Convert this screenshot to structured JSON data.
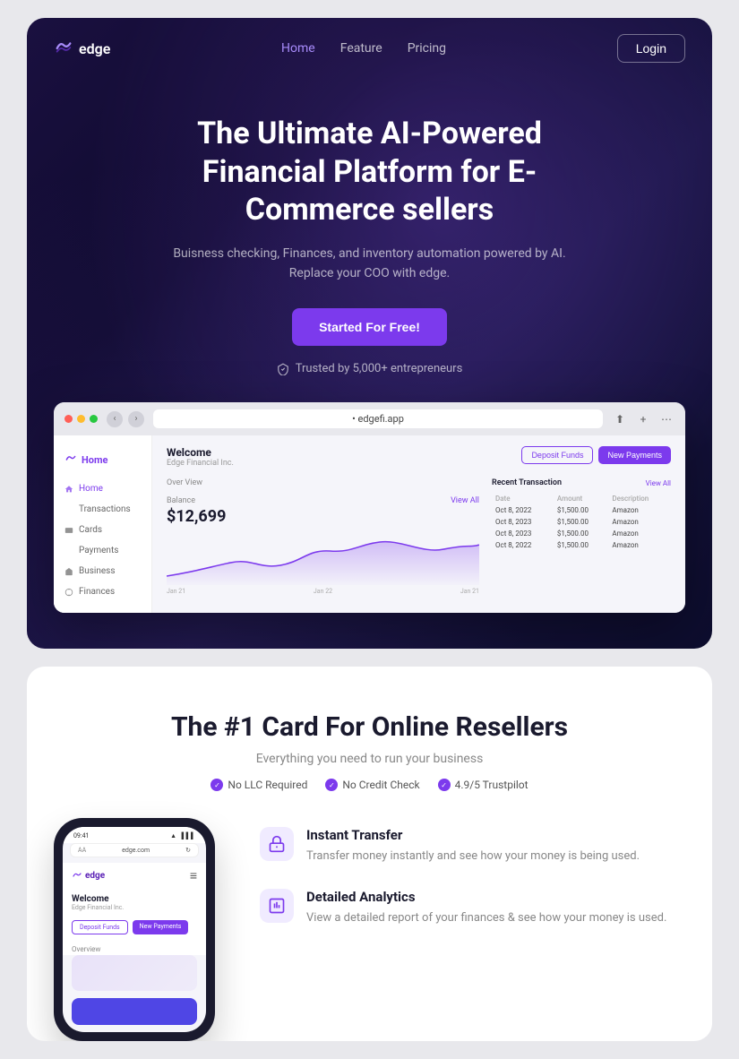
{
  "nav": {
    "logo_text": "edge",
    "links": [
      {
        "label": "Home",
        "active": true
      },
      {
        "label": "Feature",
        "active": false
      },
      {
        "label": "Pricing",
        "active": false
      }
    ],
    "login_label": "Login"
  },
  "hero": {
    "title": "The Ultimate AI-Powered Financial Platform for E-Commerce sellers",
    "subtitle_line1": "Buisness checking, Finances, and inventory automation powered by AI.",
    "subtitle_line2": "Replace your COO with edge.",
    "cta_label": "Started For Free!",
    "trust_text": "Trusted by 5,000+ entrepreneurs"
  },
  "browser": {
    "url": "• edgefi.app",
    "welcome": "Welcome",
    "company": "Edge Financial Inc.",
    "deposit_label": "Deposit Funds",
    "payments_label": "New Payments",
    "overview_label": "Over View",
    "balance_label": "Balance",
    "view_all": "View All",
    "balance_amount": "$12,699",
    "chart_dates": [
      "Jan 21",
      "Jan 22",
      "Jan 21"
    ],
    "recent_transactions": "Recent Transaction",
    "transaction_headers": [
      "Date",
      "Amount",
      "Description"
    ],
    "transactions": [
      {
        "date": "Oct 8, 2022",
        "amount": "$1,500.00",
        "desc": "Amazon"
      },
      {
        "date": "Oct 8, 2023",
        "amount": "$1,500.00",
        "desc": "Amazon"
      },
      {
        "date": "Oct 8, 2023",
        "amount": "$1,500.00",
        "desc": "Amazon"
      },
      {
        "date": "Oct 8, 2022",
        "amount": "$1,500.00",
        "desc": "Amazon"
      }
    ],
    "sidebar_items": [
      "Home",
      "Transactions",
      "Cards",
      "Payments",
      "Business",
      "Finances"
    ]
  },
  "card_section": {
    "title": "The #1 Card For Online Resellers",
    "subtitle": "Everything you need to run your business",
    "badges": [
      {
        "label": "No LLC Required"
      },
      {
        "label": "No Credit Check"
      },
      {
        "label": "4.9/5 Trustpilot"
      }
    ],
    "phone": {
      "time": "09:41",
      "url": "edge.com",
      "logo_text": "edge",
      "welcome": "Welcome",
      "company": "Edge Financial Inc.",
      "deposit_label": "Deposit Funds",
      "payments_label": "New Payments",
      "overview_label": "Overview"
    },
    "features": [
      {
        "title": "Instant Transfer",
        "desc": "Transfer money instantly and see how your money is being used.",
        "icon": "transfer"
      },
      {
        "title": "Detailed Analytics",
        "desc": "View a detailed report of your finances & see how your money is used.",
        "icon": "analytics"
      }
    ]
  }
}
